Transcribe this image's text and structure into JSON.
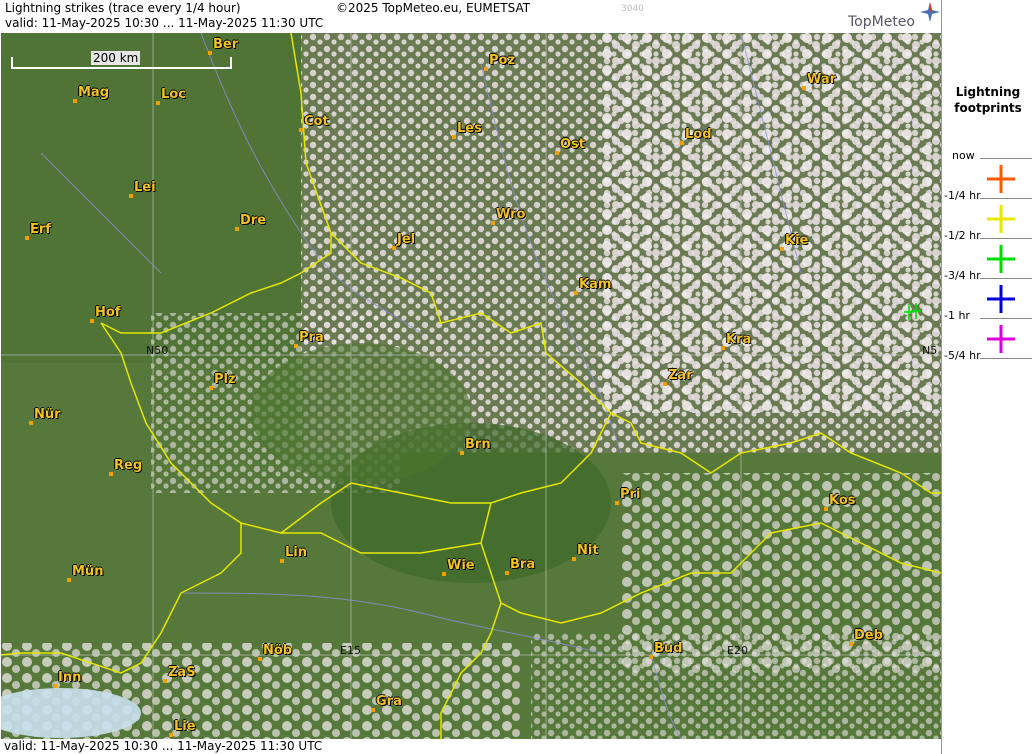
{
  "header": {
    "title": "Lightning strikes (trace every 1/4 hour)",
    "valid": "valid:  11-May-2025 10:30 ... 11-May-2025 11:30 UTC",
    "copyright": "©2025 TopMeteo.eu, EUMETSAT",
    "code": "3040",
    "logo": "TopMeteo"
  },
  "footer": {
    "valid": "valid:  11-May-2025 10:30 ... 11-May-2025 11:30 UTC"
  },
  "map": {
    "scale_label": "200 km",
    "coords": {
      "n50_left": "N50",
      "n50_right": "N5",
      "e15": "E15",
      "e20": "E20"
    },
    "cities": [
      {
        "name": "Ber"
      },
      {
        "name": "Poz"
      },
      {
        "name": "War"
      },
      {
        "name": "Mag"
      },
      {
        "name": "Loc"
      },
      {
        "name": "Cot"
      },
      {
        "name": "Les"
      },
      {
        "name": "Lod"
      },
      {
        "name": "Ost"
      },
      {
        "name": "Lei"
      },
      {
        "name": "Wro"
      },
      {
        "name": "Dre"
      },
      {
        "name": "Erf"
      },
      {
        "name": "Jel"
      },
      {
        "name": "Kie"
      },
      {
        "name": "Kam"
      },
      {
        "name": "Hof"
      },
      {
        "name": "Pra"
      },
      {
        "name": "Kra"
      },
      {
        "name": "Zar"
      },
      {
        "name": "Plz"
      },
      {
        "name": "Nür"
      },
      {
        "name": "Brn"
      },
      {
        "name": "Reg"
      },
      {
        "name": "Pri"
      },
      {
        "name": "Kos"
      },
      {
        "name": "Lin"
      },
      {
        "name": "Nit"
      },
      {
        "name": "Wie"
      },
      {
        "name": "Bra"
      },
      {
        "name": "Mün"
      },
      {
        "name": "Deb"
      },
      {
        "name": "Bud"
      },
      {
        "name": "Nöb"
      },
      {
        "name": "Inn"
      },
      {
        "name": "ZaS"
      },
      {
        "name": "Gra"
      },
      {
        "name": "Lie"
      }
    ]
  },
  "legend": {
    "title_line1": "Lightning",
    "title_line2": "footprints",
    "items": [
      {
        "label": "now",
        "color": "#ff5a00"
      },
      {
        "label": "-1/4 hr",
        "color": "#e8e800"
      },
      {
        "label": "-1/2 hr",
        "color": "#00dd00"
      },
      {
        "label": "-3/4 hr",
        "color": "#0000dd"
      },
      {
        "label": "-1 hr",
        "color": "#dd00dd"
      },
      {
        "label": "-5/4 hr"
      }
    ]
  },
  "strikes": [
    {
      "color": "#00dd00",
      "count": 2
    }
  ]
}
